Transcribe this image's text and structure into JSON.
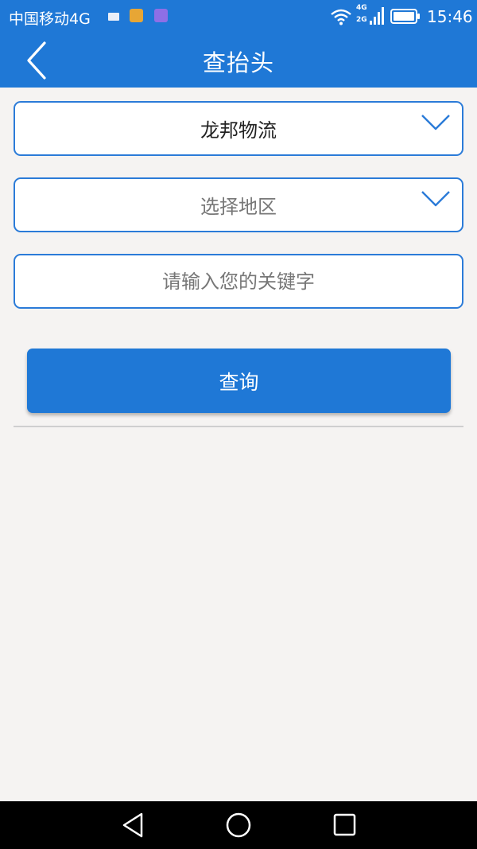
{
  "status_bar": {
    "carrier": "中国移动4G",
    "network_top": "4G",
    "network_bottom": "2G",
    "time": "15:46",
    "icons": [
      "sim-card-icon",
      "notification-app-icon",
      "gallery-app-icon",
      "wifi-icon",
      "signal-icon",
      "battery-icon"
    ]
  },
  "app_bar": {
    "title": "查抬头",
    "back_icon": "chevron-left-icon"
  },
  "form": {
    "company_select": {
      "value": "龙邦物流",
      "icon": "chevron-down-icon"
    },
    "region_select": {
      "placeholder": "选择地区",
      "icon": "chevron-down-icon"
    },
    "keyword_input": {
      "value": "",
      "placeholder": "请输入您的关键字"
    },
    "query_button": {
      "label": "查询"
    }
  },
  "nav_bar": {
    "icons": [
      "back-triangle-icon",
      "home-circle-icon",
      "recents-square-icon"
    ]
  },
  "colors": {
    "primary": "#1f78d6",
    "border": "#2b7bd8",
    "background": "#f5f3f2"
  }
}
